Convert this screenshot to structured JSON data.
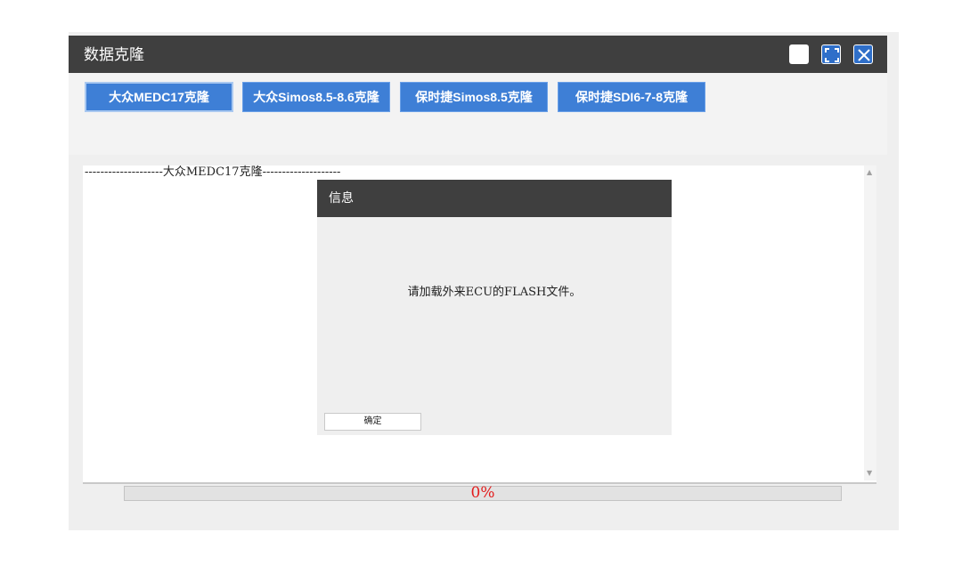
{
  "window": {
    "title": "数据克隆",
    "controls": [
      "minimize-icon",
      "maximize-icon",
      "close-icon"
    ]
  },
  "toolbar": {
    "buttons": [
      {
        "label": "大众MEDC17克隆",
        "active": true
      },
      {
        "label": "大众Simos8.5-8.6克隆",
        "active": false
      },
      {
        "label": "保时捷Simos8.5克隆",
        "active": false
      },
      {
        "label": "保时捷SDI6-7-8克隆",
        "active": false
      }
    ]
  },
  "log": {
    "line": "--------------------大众MEDC17克隆--------------------"
  },
  "dialog": {
    "title": "信息",
    "message": "请加载外来ECU的FLASH文件。",
    "ok_label": "确定"
  },
  "progress": {
    "value": 0,
    "label": "0%"
  },
  "colors": {
    "titlebar": "#3f3f3f",
    "button": "#3e7fd6",
    "progress_text": "#e31b1b"
  }
}
